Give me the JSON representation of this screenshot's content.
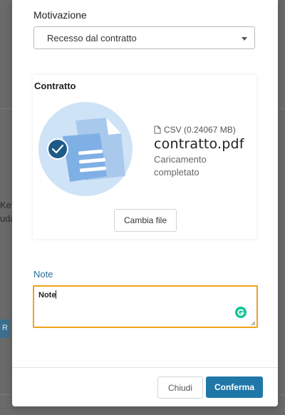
{
  "background": {
    "fragment_1": "Ke",
    "fragment_2": "uda",
    "chip_text": "R"
  },
  "form": {
    "motivation_label": "Motivazione",
    "motivation_value": "Recesso dal contratto",
    "contract_label": "Contratto",
    "file": {
      "type_info": "CSV (0.24067 MB)",
      "name": "contratto.pdf",
      "status": "Caricamento completato"
    },
    "change_file_label": "Cambia file",
    "notes_label": "Note",
    "notes_value": "Note"
  },
  "footer": {
    "close_label": "Chiudi",
    "confirm_label": "Conferma"
  },
  "colors": {
    "accent": "#1f77a8",
    "focus_border": "#f0a21c",
    "illustration_circle": "#cfe3f7",
    "check_badge": "#1d5a87",
    "grammarly": "#15c39a"
  },
  "icons": {
    "file_type": "file-icon",
    "dropdown": "chevron-down-icon",
    "upload_done": "check-icon",
    "assistant": "grammarly-icon"
  }
}
